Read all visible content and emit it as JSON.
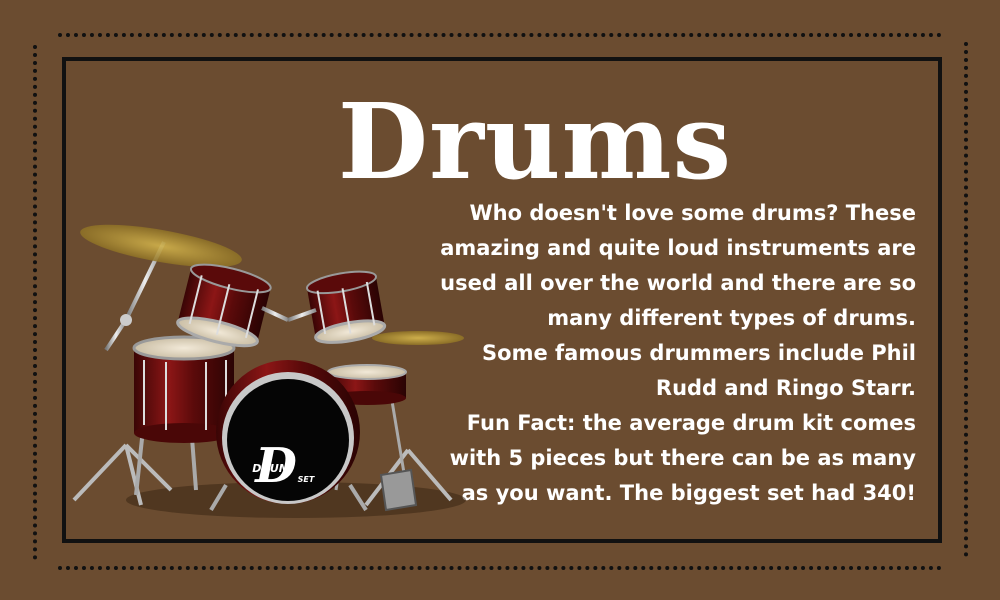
{
  "title": "Drums",
  "paragraphs": {
    "intro": "Who doesn't love some drums? These amazing and quite loud instruments are used all over the world and there are so many different types of drums.",
    "drummers": "Some famous drummers include Phil Rudd and Ringo Starr.",
    "fun_fact": "Fun Fact: the average drum kit comes with 5 pieces but there can be as many as you want. The biggest set had 340!"
  },
  "bass_drum_logo": {
    "letter": "D",
    "word_top": "DRUM",
    "word_bottom": "SET"
  },
  "colors": {
    "background": "#6b4c30",
    "border": "#111111",
    "text": "#ffffff",
    "drum_shell": "#7a1010",
    "cymbal": "#c9a640"
  }
}
